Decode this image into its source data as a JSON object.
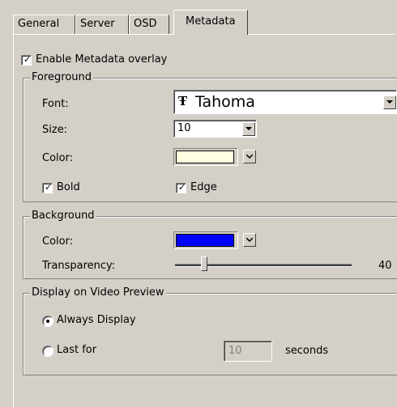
{
  "tabs": [
    "General",
    "Server",
    "OSD",
    "Metadata"
  ],
  "enable_overlay": {
    "label": "Enable Metadata overlay",
    "checked": true
  },
  "foreground": {
    "title": "Foreground",
    "font_label": "Font:",
    "font_value": "Tahoma",
    "font_icon": "truetype-font-icon",
    "size_label": "Size:",
    "size_value": "10",
    "color_label": "Color:",
    "color_value": "#ffffe0",
    "bold": {
      "label": "Bold",
      "checked": true
    },
    "edge": {
      "label": "Edge",
      "checked": true
    }
  },
  "background": {
    "title": "Background",
    "color_label": "Color:",
    "color_value": "#0000ff",
    "transparency_label": "Transparency:",
    "transparency_value": "40"
  },
  "display": {
    "title": "Display on Video Preview",
    "always_label": "Always Display",
    "last_for_label": "Last for",
    "seconds_value": "10",
    "seconds_label": "seconds",
    "selected": "always"
  }
}
